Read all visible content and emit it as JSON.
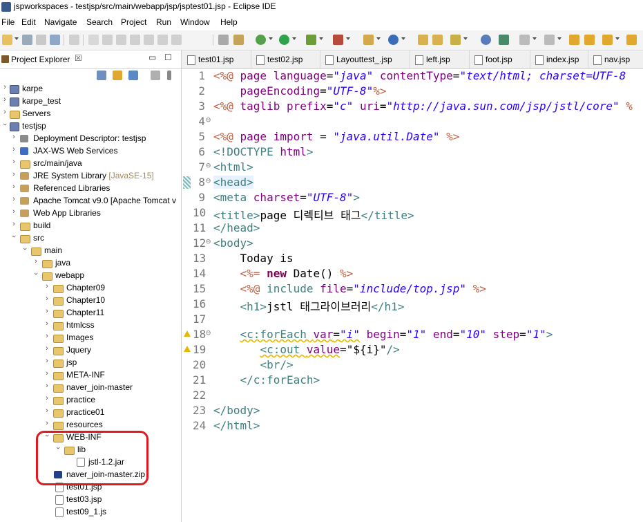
{
  "window": {
    "title": "jspworkspaces - testjsp/src/main/webapp/jsp/jsptest01.jsp - Eclipse IDE"
  },
  "menu": [
    "File",
    "Edit",
    "Navigate",
    "Search",
    "Project",
    "Run",
    "Window",
    "Help"
  ],
  "explorer": {
    "title": "Project Explorer",
    "close_glyph": "☒",
    "min_glyph": "▭",
    "max_glyph": "☐",
    "tree": [
      {
        "label": "karpe",
        "icon": "project-icon",
        "open": false
      },
      {
        "label": "karpe_test",
        "icon": "project-icon",
        "open": false
      },
      {
        "label": "Servers",
        "icon": "folder-icon",
        "open": false
      },
      {
        "label": "testjsp",
        "icon": "project-icon",
        "open": true
      },
      {
        "label": "Deployment Descriptor: testjsp",
        "icon": "descriptor-icon",
        "open": false
      },
      {
        "label": "JAX-WS Web Services",
        "icon": "webservice-icon",
        "open": false
      },
      {
        "label": "src/main/java",
        "icon": "package-icon",
        "open": false
      },
      {
        "label": "JRE System Library",
        "deco": "[JavaSE-15]",
        "icon": "library-icon",
        "open": false
      },
      {
        "label": "Referenced Libraries",
        "icon": "library-icon",
        "open": false
      },
      {
        "label": "Apache Tomcat v9.0 [Apache Tomcat v",
        "icon": "server-icon",
        "open": false
      },
      {
        "label": "Web App Libraries",
        "icon": "library-icon",
        "open": false
      },
      {
        "label": "build",
        "icon": "folder-icon",
        "open": false
      },
      {
        "label": "src",
        "icon": "folder-icon",
        "open": true
      },
      {
        "label": "main",
        "icon": "folder-icon",
        "open": true
      },
      {
        "label": "java",
        "icon": "folder-icon",
        "open": false
      },
      {
        "label": "webapp",
        "icon": "folder-icon",
        "open": true
      },
      {
        "label": "Chapter09",
        "icon": "folder-icon",
        "open": false
      },
      {
        "label": "Chapter10",
        "icon": "folder-icon",
        "open": false
      },
      {
        "label": "Chapter11",
        "icon": "folder-icon",
        "open": false
      },
      {
        "label": "htmlcss",
        "icon": "folder-icon",
        "open": false
      },
      {
        "label": "Images",
        "icon": "folder-icon",
        "open": false
      },
      {
        "label": "Jquery",
        "icon": "folder-icon",
        "open": false
      },
      {
        "label": "jsp",
        "icon": "folder-icon",
        "open": false
      },
      {
        "label": "META-INF",
        "icon": "folder-icon",
        "open": false
      },
      {
        "label": "naver_join-master",
        "icon": "folder-icon",
        "open": false
      },
      {
        "label": "practice",
        "icon": "folder-icon",
        "open": false
      },
      {
        "label": "practice01",
        "icon": "folder-icon",
        "open": false
      },
      {
        "label": "resources",
        "icon": "folder-icon",
        "open": false
      },
      {
        "label": "WEB-INF",
        "icon": "folder-icon",
        "open": true
      },
      {
        "label": "lib",
        "icon": "folder-icon",
        "open": true
      },
      {
        "label": "jstl-1.2.jar",
        "icon": "jar-icon",
        "open": false
      },
      {
        "label": "naver_join-master.zip",
        "icon": "zip-icon",
        "open": false
      },
      {
        "label": "test01.jsp",
        "icon": "jsp-file-icon",
        "open": false
      },
      {
        "label": "test03.jsp",
        "icon": "jsp-file-icon",
        "open": false
      },
      {
        "label": "test09_1.js",
        "icon": "js-file-icon",
        "open": false
      }
    ]
  },
  "editor": {
    "tabs": [
      "test01.jsp",
      "test02.jsp",
      "Layouttest_.jsp",
      "left.jsp",
      "foot.jsp",
      "index.jsp",
      "nav.jsp"
    ],
    "lines": [
      {
        "n": "1"
      },
      {
        "n": "2"
      },
      {
        "n": "3"
      },
      {
        "n": "4",
        "marker": "⊖"
      },
      {
        "n": "5"
      },
      {
        "n": "6"
      },
      {
        "n": "7",
        "marker": "⊖"
      },
      {
        "n": "8",
        "marker": "⊖"
      },
      {
        "n": "9"
      },
      {
        "n": "10"
      },
      {
        "n": "11"
      },
      {
        "n": "12",
        "marker": "⊖"
      },
      {
        "n": "13"
      },
      {
        "n": "14"
      },
      {
        "n": "15"
      },
      {
        "n": "16"
      },
      {
        "n": "17"
      },
      {
        "n": "18",
        "marker": "⊖",
        "warning": true
      },
      {
        "n": "19",
        "warning": true
      },
      {
        "n": "20"
      },
      {
        "n": "21"
      },
      {
        "n": "22"
      },
      {
        "n": "23"
      },
      {
        "n": "24"
      }
    ],
    "code": {
      "l1_a": "<%@ ",
      "l1_b": "page ",
      "l1_c": "language",
      "l1_d": "=",
      "l1_e": "\"java\"",
      "l1_f": " contentType",
      "l1_g": "=",
      "l1_h": "\"text/html; charset=UTF-8",
      "l2_a": "    pageEncoding",
      "l2_b": "=",
      "l2_c": "\"UTF-8\"",
      "l2_d": "%>",
      "l3_a": "<%@ ",
      "l3_b": "taglib ",
      "l3_c": "prefix",
      "l3_d": "=",
      "l3_e": "\"c\"",
      "l3_f": " uri",
      "l3_g": "=",
      "l3_h": "\"http://java.sun.com/jsp/jstl/core\"",
      "l3_i": " %",
      "l5_a": "<%@ ",
      "l5_b": "page ",
      "l5_c": "import",
      "l5_d": " = ",
      "l5_e": "\"java.util.Date\"",
      "l5_f": " %>",
      "l6_a": "<!DOCTYPE ",
      "l6_b": "html",
      "l6_c": ">",
      "l7_a": "<html>",
      "l8_a": "<head>",
      "l9_a": "<meta ",
      "l9_b": "charset",
      "l9_c": "=",
      "l9_d": "\"UTF-8\"",
      "l9_e": ">",
      "l10_a": "<title>",
      "l10_b": "page 디렉티브 태그",
      "l10_c": "</title>",
      "l11_a": "</head>",
      "l12_a": "<body>",
      "l13_a": "    Today is",
      "l14_a": "    ",
      "l14_b": "<%= ",
      "l14_c": "new",
      "l14_d": " Date() ",
      "l14_e": "%>",
      "l15_a": "    ",
      "l15_b": "<%@ ",
      "l15_c": "include ",
      "l15_d": "file",
      "l15_e": "=",
      "l15_f": "\"include/top.jsp\"",
      "l15_g": " %>",
      "l16_a": "    ",
      "l16_b": "<h1>",
      "l16_c": "jstl 태그라이브러리",
      "l16_d": "</h1>",
      "l18_a": "    ",
      "l18_b": "<c:forEach ",
      "l18_c": "var",
      "l18_d": "=",
      "l18_e": "\"i\"",
      "l18_f": " begin",
      "l18_g": "=",
      "l18_h": "\"1\"",
      "l18_i": " end",
      "l18_j": "=",
      "l18_k": "\"10\"",
      "l18_l": " step",
      "l18_m": "=",
      "l18_n": "\"1\"",
      "l18_o": ">",
      "l19_a": "       ",
      "l19_b": "<c:out ",
      "l19_c": "value",
      "l19_d": "=",
      "l19_e": "\"${i}\"",
      "l19_f": "/>",
      "l20_a": "       ",
      "l20_b": "<br/>",
      "l21_a": "    ",
      "l21_b": "</c:forEach>",
      "l23_a": "</body>",
      "l24_a": "</html>"
    }
  },
  "colors": {
    "highlight_ring": "#e0191f",
    "tag": "#3f7f7f",
    "attribute": "#7f007f",
    "string": "#2a00ff",
    "directive": "#bf5f3f",
    "keyword": "#7f0055"
  }
}
